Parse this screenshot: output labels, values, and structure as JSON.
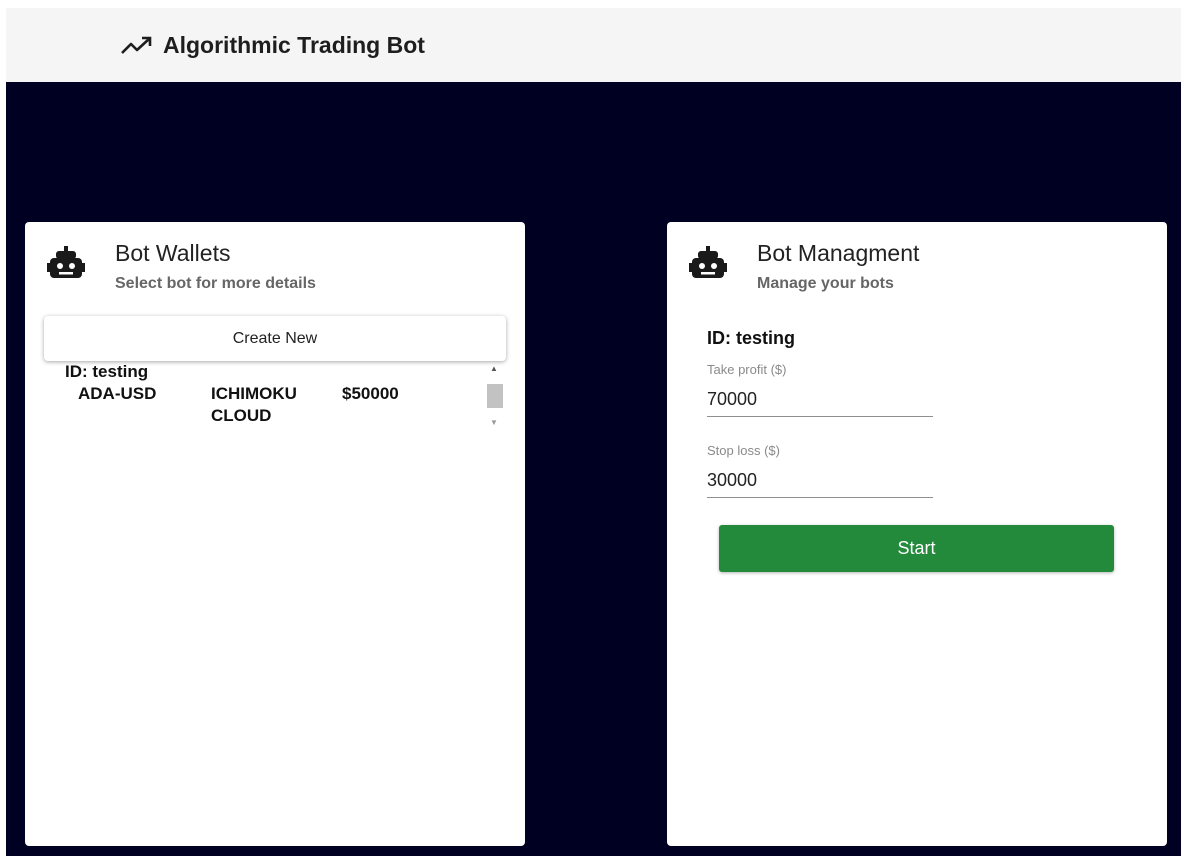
{
  "appbar": {
    "icon": "trending-up-icon",
    "title": "Algorithmic Trading Bot"
  },
  "colors": {
    "appbar_bg": "#f5f5f5",
    "stage_bg": "#000022",
    "start_button": "#238a3c"
  },
  "wallets": {
    "icon": "robot-icon",
    "title": "Bot Wallets",
    "subtitle": "Select bot for more details",
    "create_label": "Create New",
    "items": [
      {
        "id_label": "ID: testing",
        "pair": "ADA-USD",
        "strategy": "ICHIMOKU CLOUD",
        "amount": "$50000"
      }
    ]
  },
  "management": {
    "icon": "robot-icon",
    "title": "Bot Managment",
    "subtitle": "Manage your bots",
    "bot_id_label": "ID: testing",
    "take_profit": {
      "label": "Take profit ($)",
      "value": "70000"
    },
    "stop_loss": {
      "label": "Stop loss ($)",
      "value": "30000"
    },
    "start_label": "Start"
  }
}
